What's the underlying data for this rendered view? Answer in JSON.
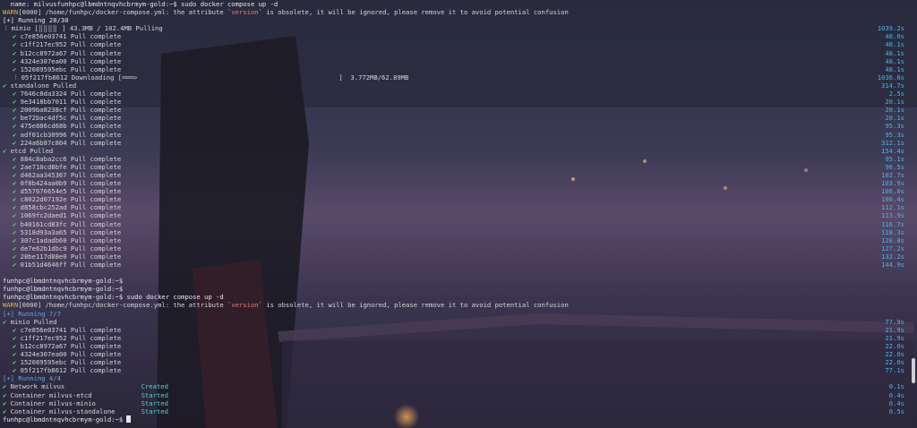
{
  "colors": {
    "background": "#2a2a3d",
    "warn": "#e0b24a",
    "version": "#e07a7a",
    "running": "#5aa9e6",
    "check": "#5fd37a",
    "time": "#4ab3e8"
  },
  "lines": [
    {
      "kind": "plain",
      "text": "  name: milvusfunhpc@lbmdntnqvhcbrmym-gold:~$ sudo docker compose up -d"
    },
    {
      "kind": "warn",
      "pre": "WARN",
      "mid": "[0000] /home/funhpc/docker-compose.yml: the attribute `",
      "ver": "version",
      "post": "` is obsolete, it will be ignored, please remove it to avoid potential confusion"
    },
    {
      "kind": "plain",
      "text": "[+] Running 28/30"
    },
    {
      "kind": "pulling",
      "mark": "⠸",
      "text": " minio [⣿⣿⣿⣿⠀] 43.3MB / 102.4MB Pulling",
      "time": "1039.2s"
    },
    {
      "kind": "sub",
      "text": "c7e856e03741 Pull complete",
      "time": "48.0s"
    },
    {
      "kind": "sub",
      "text": "c1ff217ec952 Pull complete",
      "time": "48.1s"
    },
    {
      "kind": "sub",
      "text": "b12cc8972a67 Pull complete",
      "time": "48.1s"
    },
    {
      "kind": "sub",
      "text": "4324e307ea00 Pull complete",
      "time": "48.1s"
    },
    {
      "kind": "sub",
      "text": "152089595ebc Pull complete",
      "time": "48.1s"
    },
    {
      "kind": "dl",
      "mark": "⠸",
      "text": "05f217fb8612 Downloading [═══>                                                    ]  3.772MB/62.89MB",
      "time": "1036.6s"
    },
    {
      "kind": "top",
      "text": "standalone Pulled",
      "time": "314.7s"
    },
    {
      "kind": "sub",
      "text": "7646c8da3324 Pull complete",
      "time": "2.5s"
    },
    {
      "kind": "sub",
      "text": "9e3418bb7011 Pull complete",
      "time": "20.1s"
    },
    {
      "kind": "sub",
      "text": "2009ba8238cf Pull complete",
      "time": "20.1s"
    },
    {
      "kind": "sub",
      "text": "be72bac4df5c Pull complete",
      "time": "20.1s"
    },
    {
      "kind": "sub",
      "text": "475e886cd68b Pull complete",
      "time": "95.3s"
    },
    {
      "kind": "sub",
      "text": "adf01cb30996 Pull complete",
      "time": "95.3s"
    },
    {
      "kind": "sub",
      "text": "224a6b87c804 Pull complete",
      "time": "312.1s"
    },
    {
      "kind": "top",
      "text": "etcd Pulled",
      "time": "154.4s"
    },
    {
      "kind": "sub",
      "text": "884c8aba2cc6 Pull complete",
      "time": "95.1s"
    },
    {
      "kind": "sub",
      "text": "2ae710cd8bfe Pull complete",
      "time": "96.5s"
    },
    {
      "kind": "sub",
      "text": "d462aa345367 Pull complete",
      "time": "102.7s"
    },
    {
      "kind": "sub",
      "text": "0f8b424aa0b9 Pull complete",
      "time": "103.9s"
    },
    {
      "kind": "sub",
      "text": "d557676654e5 Pull complete",
      "time": "106.0s"
    },
    {
      "kind": "sub",
      "text": "c8022d07192e Pull complete",
      "time": "106.4s"
    },
    {
      "kind": "sub",
      "text": "d858cbc252ad Pull complete",
      "time": "112.1s"
    },
    {
      "kind": "sub",
      "text": "1069fc2daed1 Pull complete",
      "time": "113.9s"
    },
    {
      "kind": "sub",
      "text": "b40161cd83fc Pull complete",
      "time": "116.7s"
    },
    {
      "kind": "sub",
      "text": "5318d93a3a65 Pull complete",
      "time": "118.3s"
    },
    {
      "kind": "sub",
      "text": "307c1adadb60 Pull complete",
      "time": "120.8s"
    },
    {
      "kind": "sub",
      "text": "de7e62b1dbc9 Pull complete",
      "time": "127.2s"
    },
    {
      "kind": "sub",
      "text": "28be117d88e0 Pull complete",
      "time": "132.2s"
    },
    {
      "kind": "sub",
      "text": "01b51d4646ff Pull complete",
      "time": "144.9s"
    },
    {
      "kind": "blank",
      "text": ""
    },
    {
      "kind": "plain",
      "text": "funhpc@lbmdntnqvhcbrmym-gold:~$"
    },
    {
      "kind": "plain",
      "text": "funhpc@lbmdntnqvhcbrmym-gold:~$"
    },
    {
      "kind": "plain",
      "text": "funhpc@lbmdntnqvhcbrmym-gold:~$ sudo docker compose up -d"
    },
    {
      "kind": "warn",
      "pre": "WARN",
      "mid": "[0000] /home/funhpc/docker-compose.yml: the attribute `",
      "ver": "version",
      "post": "` is obsolete, it will be ignored, please remove it to avoid potential confusion"
    },
    {
      "kind": "running",
      "text": "[+] Running 7/7"
    },
    {
      "kind": "top",
      "text": "minio Pulled",
      "time": "77.9s"
    },
    {
      "kind": "sub",
      "text": "c7e856e03741 Pull complete",
      "time": "21.9s"
    },
    {
      "kind": "sub",
      "text": "c1ff217ec952 Pull complete",
      "time": "21.9s"
    },
    {
      "kind": "sub",
      "text": "b12cc8972a67 Pull complete",
      "time": "22.0s"
    },
    {
      "kind": "sub",
      "text": "4324e307ea00 Pull complete",
      "time": "22.0s"
    },
    {
      "kind": "sub",
      "text": "152089595ebc Pull complete",
      "time": "22.0s"
    },
    {
      "kind": "sub",
      "text": "05f217fb8612 Pull complete",
      "time": "77.1s"
    },
    {
      "kind": "running",
      "text": "[+] Running 4/4"
    },
    {
      "kind": "svc",
      "name": "Network milvus",
      "status": "Created",
      "time": "0.1s"
    },
    {
      "kind": "svc",
      "name": "Container milvus-etcd",
      "status": "Started",
      "time": "0.4s"
    },
    {
      "kind": "svc",
      "name": "Container milvus-minio",
      "status": "Started",
      "time": "0.4s"
    },
    {
      "kind": "svc",
      "name": "Container milvus-standalone",
      "status": "Started",
      "time": "0.5s"
    },
    {
      "kind": "promptcur",
      "text": "funhpc@lbmdntnqvhcbrmym-gold:~$ "
    }
  ]
}
